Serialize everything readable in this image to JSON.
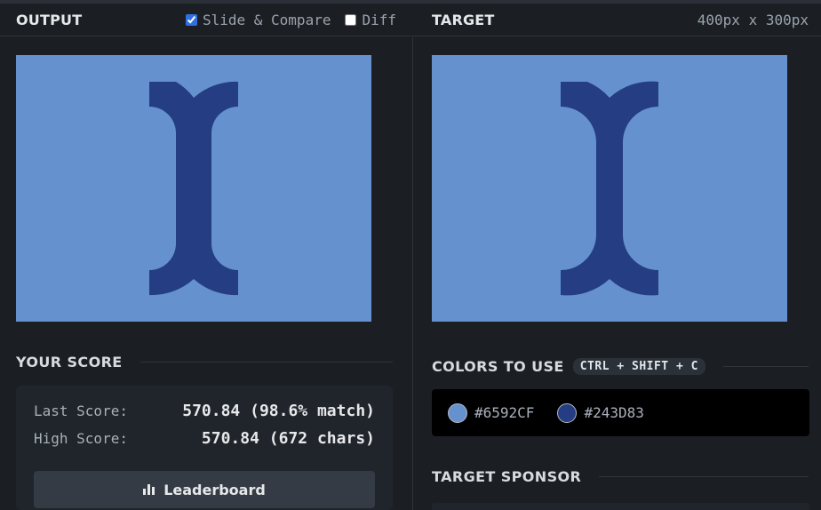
{
  "output_panel": {
    "title": "OUTPUT",
    "slide_compare": {
      "label": "Slide & Compare",
      "checked": true
    },
    "diff": {
      "label": "Diff",
      "checked": false
    }
  },
  "target_panel": {
    "title": "TARGET",
    "dimensions": "400px x 300px"
  },
  "score": {
    "title": "YOUR SCORE",
    "last_label": "Last Score:",
    "last_value": "570.84 (98.6% match)",
    "high_label": "High Score:",
    "high_value": "570.84 (672 chars)",
    "leaderboard_label": "Leaderboard"
  },
  "colors": {
    "title": "COLORS TO USE",
    "shortcut": "CTRL + SHIFT + C",
    "swatches": [
      {
        "hex": "#6592CF"
      },
      {
        "hex": "#243D83"
      }
    ]
  },
  "sponsor": {
    "title": "TARGET SPONSOR"
  },
  "theme": {
    "background": "#6592CF",
    "shape": "#243D83"
  }
}
